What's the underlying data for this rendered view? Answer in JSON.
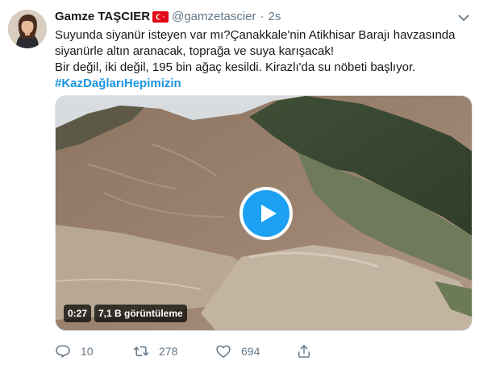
{
  "tweet": {
    "author": {
      "name": "Gamze TAŞCIER",
      "handle": "@gamzetascier"
    },
    "separator": "·",
    "time": "2s",
    "text_lines": [
      "Suyunda siyanür isteyen var mı?Çanakkale'nin Atikhisar Barajı havzasında",
      "siyanürle altın aranacak, toprağa ve suya karışacak!",
      "Bir değil, iki değil, 195 bin ağaç kesildi. Kirazlı'da su nöbeti başlıyor."
    ],
    "hashtag": "#KazDağlarıHepimizin",
    "media": {
      "duration": "0:27",
      "views": "7,1 B görüntüleme"
    },
    "actions": {
      "reply_count": "10",
      "retweet_count": "278",
      "like_count": "694"
    }
  },
  "icons": {
    "flag": "turkey-flag-icon",
    "caret": "chevron-down-icon",
    "play": "play-icon",
    "reply": "reply-icon",
    "retweet": "retweet-icon",
    "like": "heart-icon",
    "share": "share-icon"
  },
  "colors": {
    "accent": "#1da1f2",
    "hashtag": "#1b95e0",
    "secondary_text": "#657786",
    "primary_text": "#14171a",
    "flag_red": "#e30a17"
  }
}
